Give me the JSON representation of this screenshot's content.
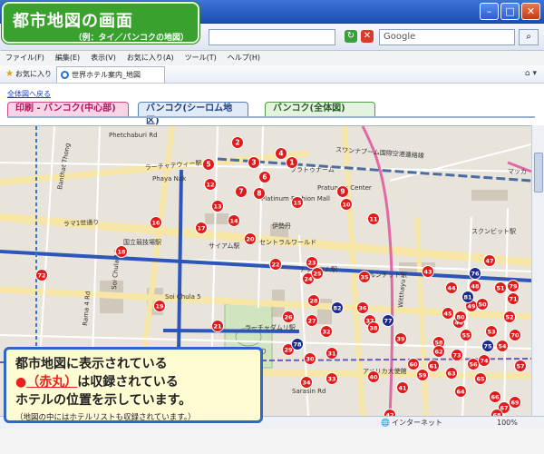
{
  "callout": {
    "title": "都市地図の画面",
    "subtitle": "（例：タイ／バンコクの地図）"
  },
  "browser": {
    "search_placeholder": "Google",
    "menu": [
      "ファイル(F)",
      "編集(E)",
      "表示(V)",
      "お気に入り(A)",
      "ツール(T)",
      "ヘルプ(H)"
    ],
    "favorites_label": "お気に入り",
    "tab_title": "世界ホテル案内_地図",
    "zoom": "100%",
    "status_zone": "インターネット"
  },
  "page": {
    "back_link": "全体図へ戻る",
    "tabs": [
      {
        "label": "印刷 - バンコク(中心部)"
      },
      {
        "label": "バンコク(シーロム地区)"
      },
      {
        "label": "バンコク(全体図)"
      }
    ]
  },
  "map": {
    "labels": [
      {
        "id": "l1",
        "text": "Phetchaburi Rd"
      },
      {
        "id": "l2",
        "text": "ラーチャテウィー駅"
      },
      {
        "id": "l3",
        "text": "Phaya Nak"
      },
      {
        "id": "l4",
        "text": "Banthat Thong"
      },
      {
        "id": "l5",
        "text": "ラマ1世通り"
      },
      {
        "id": "l6",
        "text": "国立競技場駅"
      },
      {
        "id": "l7",
        "text": "スクンビット駅"
      },
      {
        "id": "l8",
        "text": "サイアム駅"
      },
      {
        "id": "l9",
        "text": "チットロム駅"
      },
      {
        "id": "l10",
        "text": "プルンチット駅"
      },
      {
        "id": "l11",
        "text": "スワンナプーム国際空港連絡線"
      },
      {
        "id": "l12",
        "text": "プラトゥナーム"
      },
      {
        "id": "l13",
        "text": "Soi Chula 16"
      },
      {
        "id": "l14",
        "text": "Soi Chula 5"
      },
      {
        "id": "l15",
        "text": "ラーチャダムリ駅"
      },
      {
        "id": "l16",
        "text": "ラーマ4世通り"
      },
      {
        "id": "l17",
        "text": "アメリカ大使館"
      },
      {
        "id": "l18",
        "text": "Sarasin Rd"
      },
      {
        "id": "l19",
        "text": "Witthayu"
      },
      {
        "id": "l20",
        "text": "Rama 4 Rd"
      },
      {
        "id": "l21",
        "text": "セントラルワールド"
      },
      {
        "id": "l22",
        "text": "伊勢丹"
      },
      {
        "id": "l23",
        "text": "マッカ"
      },
      {
        "id": "l24",
        "text": "Platinum Fashion Mall"
      },
      {
        "id": "l25",
        "text": "Pratunam Center"
      }
    ],
    "pins": [
      "1",
      "2",
      "3",
      "4",
      "5",
      "6",
      "7",
      "8",
      "9",
      "10",
      "11",
      "12",
      "13",
      "14",
      "15",
      "16",
      "17",
      "18",
      "19",
      "20",
      "21",
      "22",
      "23",
      "24",
      "25",
      "26",
      "27",
      "28",
      "29",
      "30",
      "31",
      "32",
      "33",
      "34",
      "35",
      "36",
      "37",
      "38",
      "39",
      "40",
      "41",
      "42",
      "43",
      "44",
      "45",
      "46",
      "47",
      "48",
      "49",
      "50",
      "51",
      "52",
      "53",
      "54",
      "55",
      "56",
      "57",
      "58",
      "59",
      "60",
      "61",
      "62",
      "63",
      "64",
      "65",
      "66",
      "67",
      "68",
      "69",
      "70",
      "71",
      "72",
      "73",
      "74",
      "75",
      "76",
      "77",
      "78",
      "79",
      "80",
      "81",
      "82"
    ],
    "stations": [
      "75",
      "76",
      "77",
      "78",
      "81",
      "82"
    ]
  },
  "note": {
    "line1": "都市地図に表示されている",
    "bullet": "●",
    "paren": "（赤丸）",
    "line2_rest": "は収録されている",
    "line3": "ホテルの位置を示しています。",
    "small": "（地図の中にはホテルリストも収録されています。）"
  },
  "colors": {
    "pin": "#e11b1b",
    "station": "#1b2a8c",
    "callout_green": "#3aa12e",
    "note_border": "#2f67c8"
  }
}
